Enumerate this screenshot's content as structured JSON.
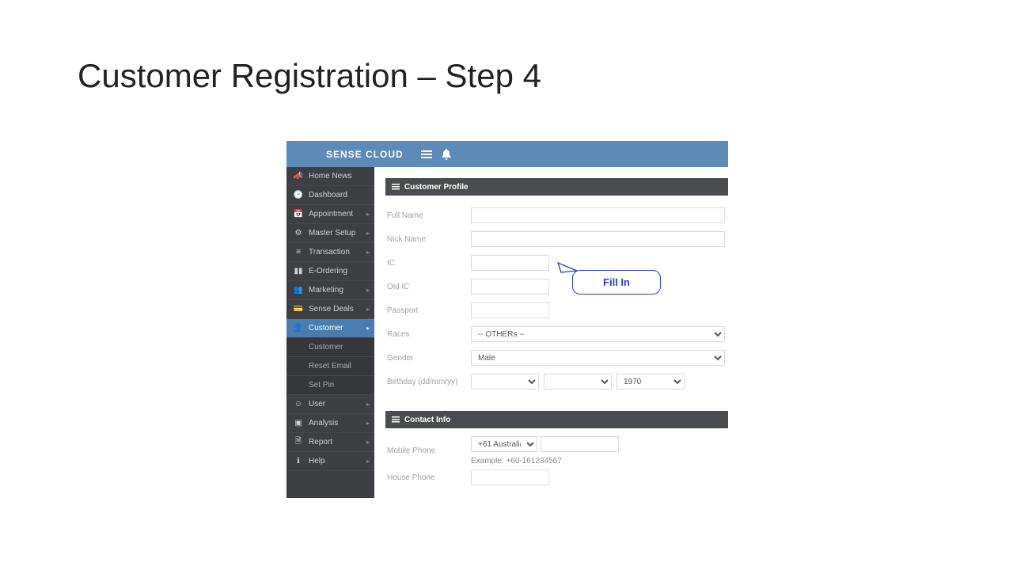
{
  "slide": {
    "title": "Customer Registration – Step 4"
  },
  "header": {
    "brand": "SENSE CLOUD"
  },
  "nav": {
    "items": [
      {
        "label": "Home News",
        "icon": "megaphone",
        "expandable": false
      },
      {
        "label": "Dashboard",
        "icon": "gauge",
        "expandable": false
      },
      {
        "label": "Appointment",
        "icon": "calendar",
        "expandable": true
      },
      {
        "label": "Master Setup",
        "icon": "cogs",
        "expandable": true
      },
      {
        "label": "Transaction",
        "icon": "list",
        "expandable": true
      },
      {
        "label": "E-Ordering",
        "icon": "barcode",
        "expandable": false
      },
      {
        "label": "Marketing",
        "icon": "users",
        "expandable": true
      },
      {
        "label": "Sense Deals",
        "icon": "card",
        "expandable": true
      },
      {
        "label": "Customer",
        "icon": "user",
        "expandable": true,
        "active": true,
        "children": [
          "Customer",
          "Reset Email",
          "Set Pin"
        ]
      },
      {
        "label": "User",
        "icon": "smile",
        "expandable": true
      },
      {
        "label": "Analysis",
        "icon": "book",
        "expandable": true
      },
      {
        "label": "Report",
        "icon": "file",
        "expandable": true
      },
      {
        "label": "Help",
        "icon": "info",
        "expandable": true
      }
    ]
  },
  "profile": {
    "panel_title": "Customer Profile",
    "fields": {
      "full_name": {
        "label": "Full Name",
        "value": ""
      },
      "nick_name": {
        "label": "Nick Name",
        "value": ""
      },
      "ic": {
        "label": "IC",
        "value": ""
      },
      "old_ic": {
        "label": "Old IC",
        "value": ""
      },
      "passport": {
        "label": "Passport",
        "value": ""
      },
      "races": {
        "label": "Races",
        "value": "-- OTHERs --"
      },
      "gender": {
        "label": "Gender",
        "value": "Male"
      },
      "birthday": {
        "label": "Birthday (dd/mm/yy)",
        "day": "",
        "month": "",
        "year": "1970"
      }
    }
  },
  "contact": {
    "panel_title": "Contact Info",
    "mobile": {
      "label": "Mobile Phone",
      "country_code": "+61 Australia",
      "number": "",
      "example": "Example: +60-161234567"
    },
    "house": {
      "label": "House Phone",
      "value": ""
    }
  },
  "callout": {
    "text": "Fill In"
  }
}
